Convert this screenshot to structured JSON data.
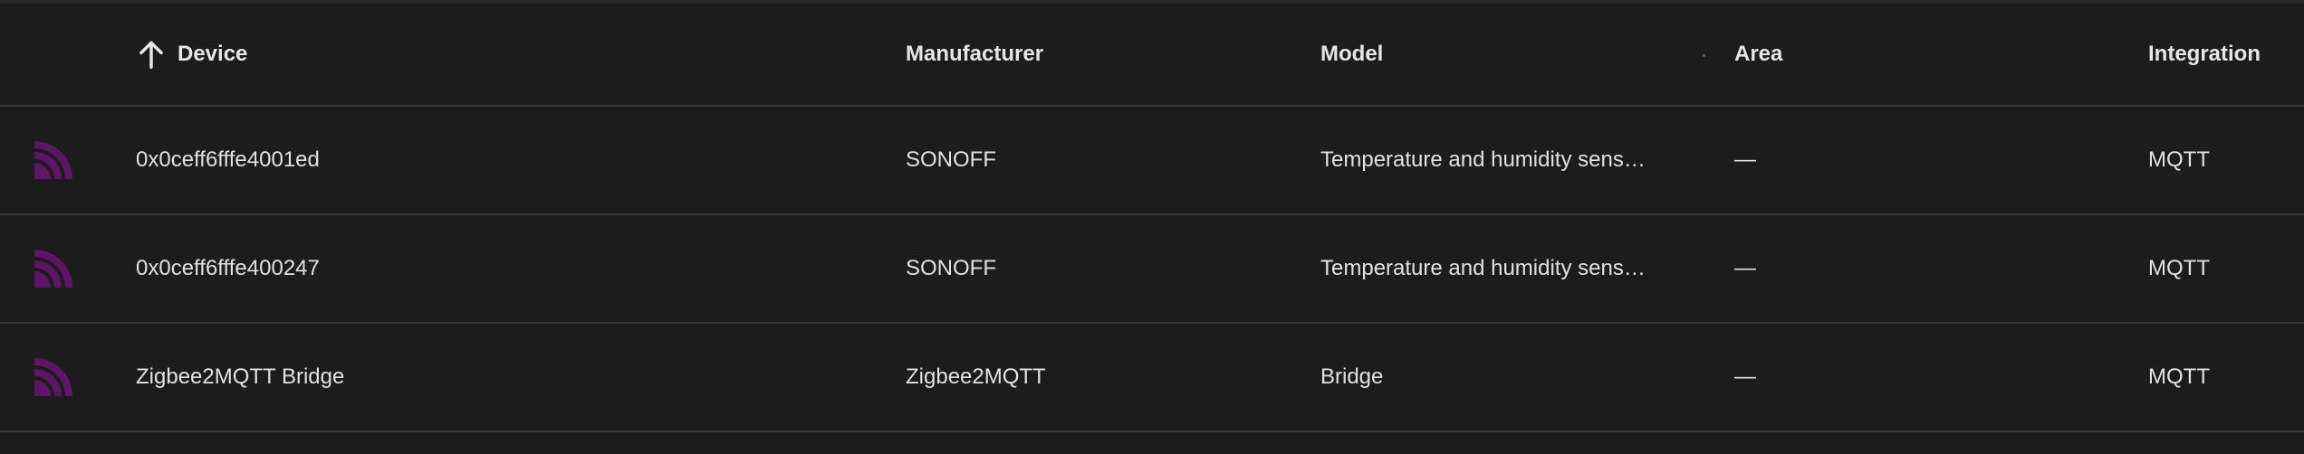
{
  "header": {
    "device": "Device",
    "manufacturer": "Manufacturer",
    "model": "Model",
    "area": "Area",
    "integration": "Integration"
  },
  "icons": {
    "sort": "arrow-up-icon",
    "device": "zigbee-icon"
  },
  "colors": {
    "background": "#1c1c1c",
    "divider": "#3a3a3a",
    "text": "#e1e1e1",
    "icon": "#5e1568"
  },
  "rows": [
    {
      "device": "0x0ceff6fffe4001ed",
      "manufacturer": "SONOFF",
      "model": "Temperature and humidity senso…",
      "area": "—",
      "integration": "MQTT"
    },
    {
      "device": "0x0ceff6fffe400247",
      "manufacturer": "SONOFF",
      "model": "Temperature and humidity senso…",
      "area": "—",
      "integration": "MQTT"
    },
    {
      "device": "Zigbee2MQTT Bridge",
      "manufacturer": "Zigbee2MQTT",
      "model": "Bridge",
      "area": "—",
      "integration": "MQTT"
    }
  ]
}
